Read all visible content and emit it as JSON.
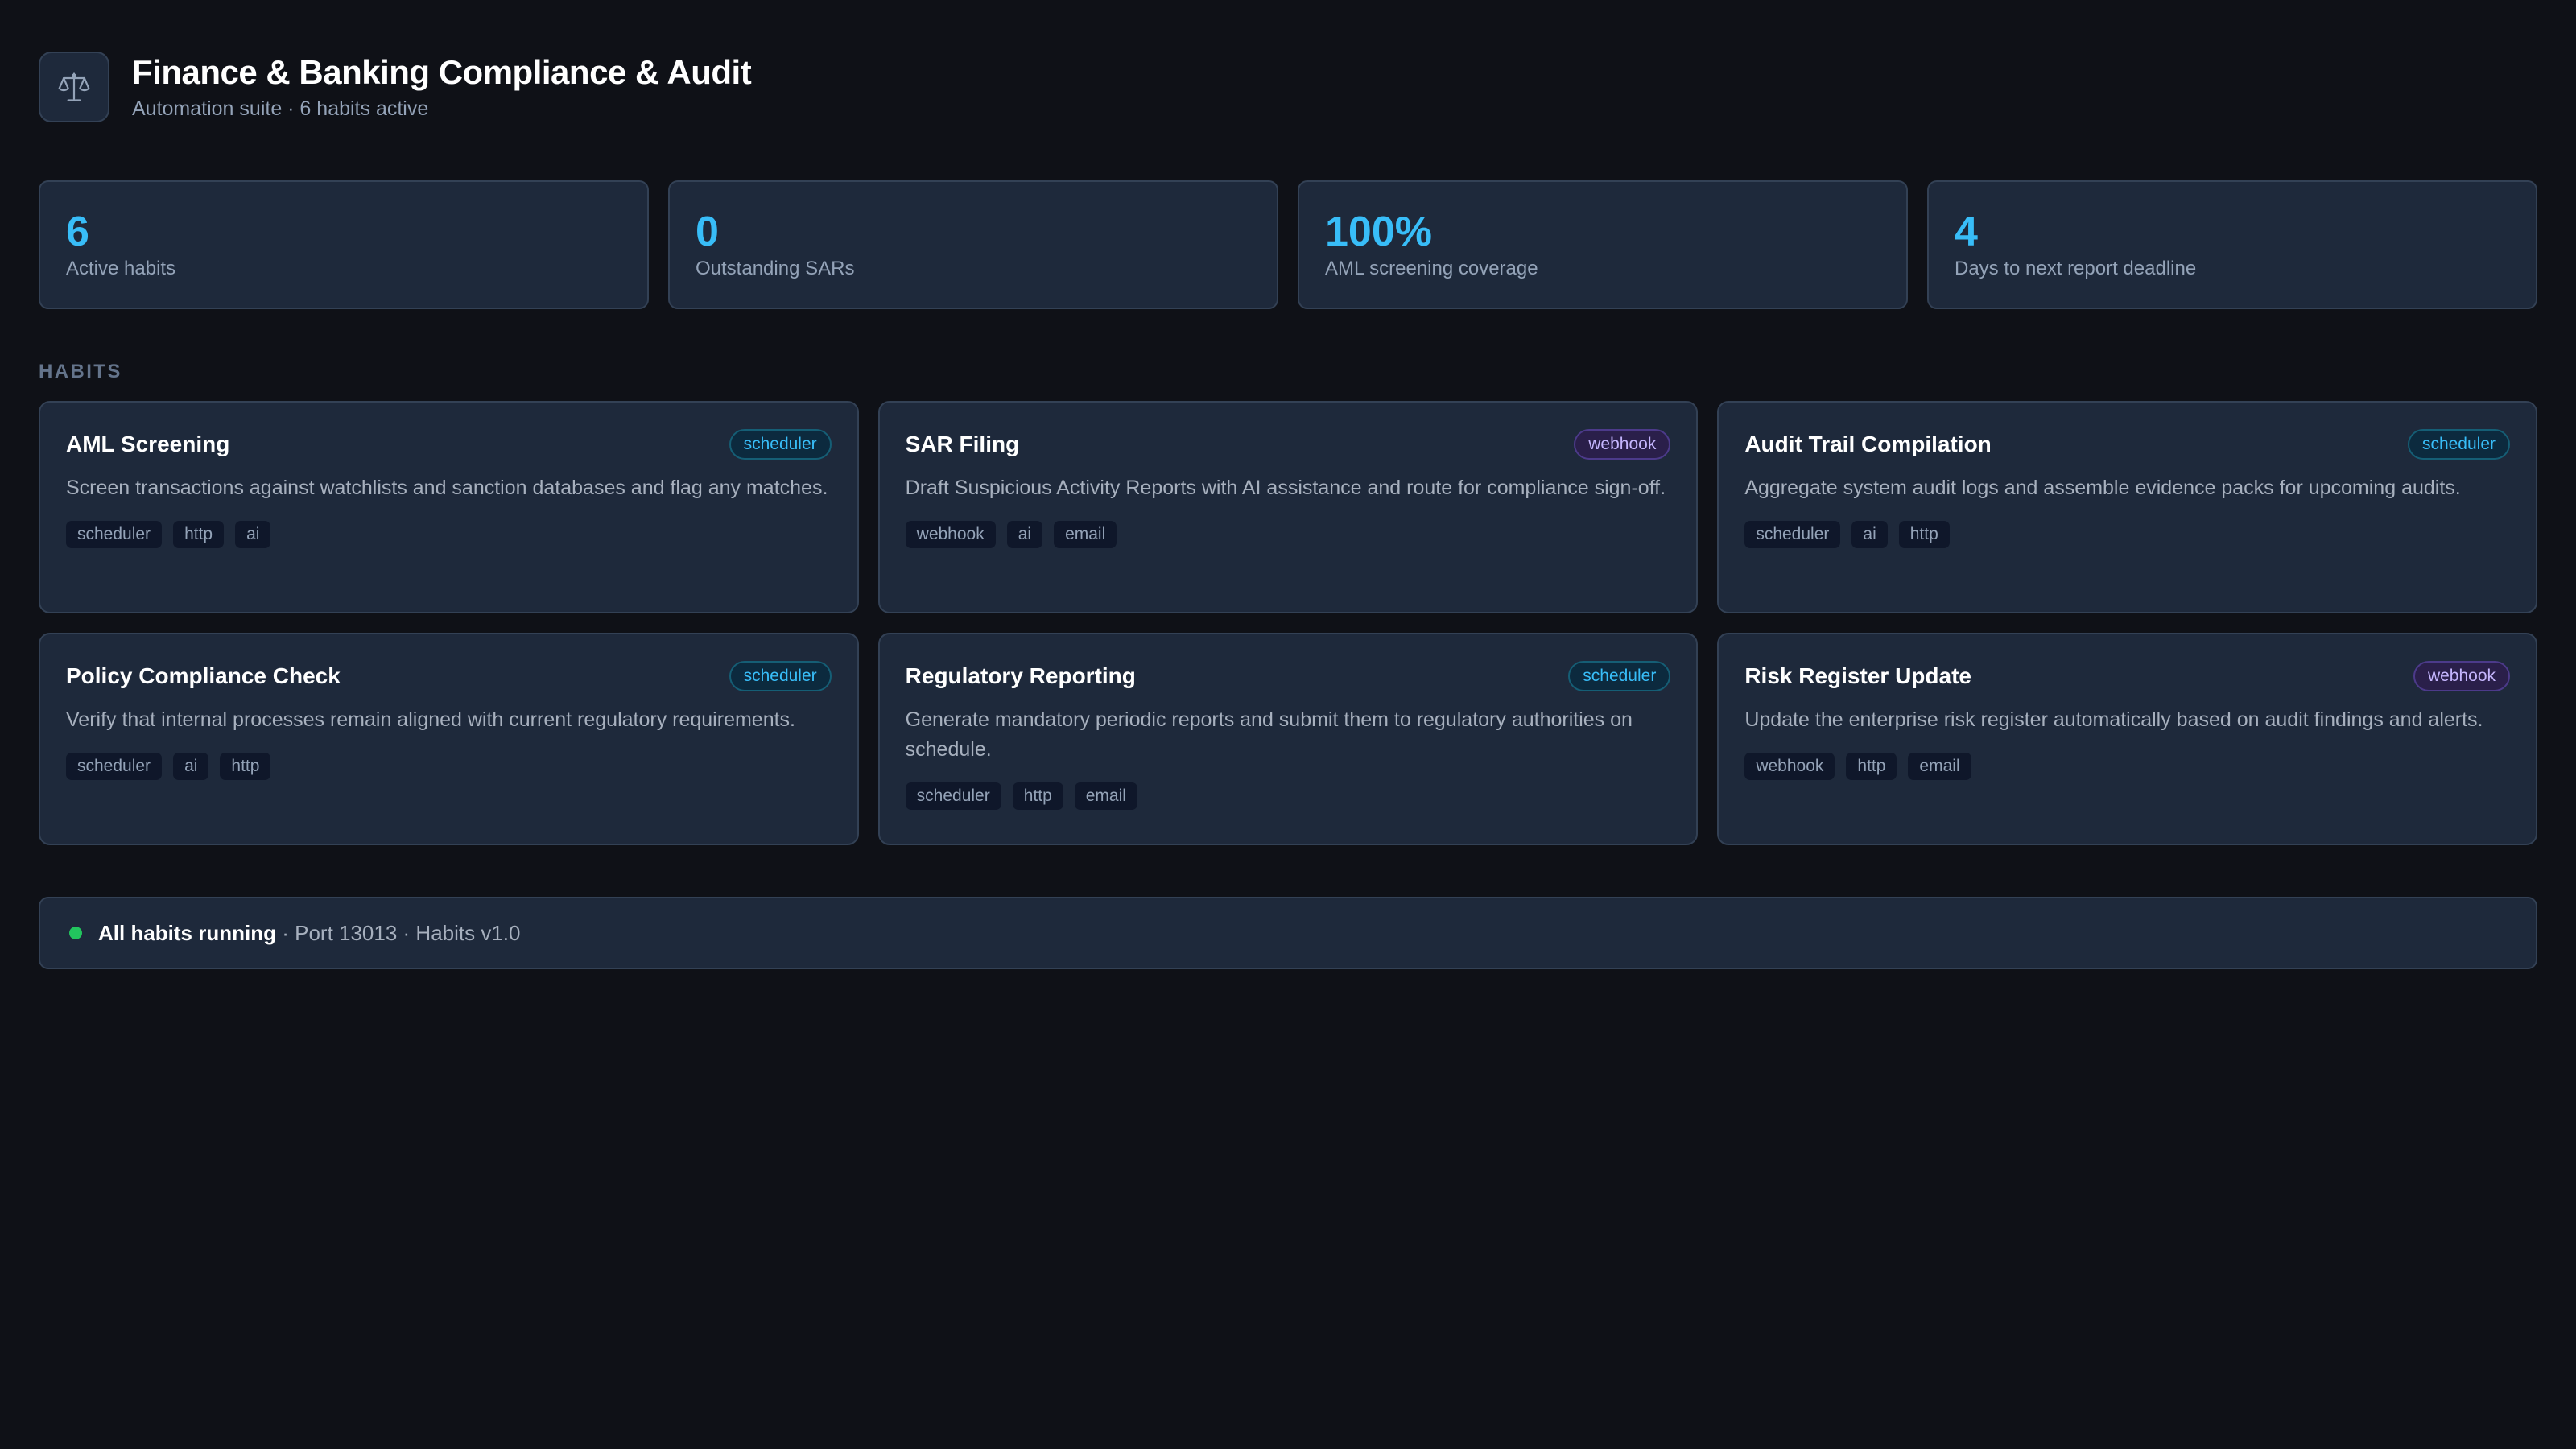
{
  "header": {
    "title": "Finance & Banking Compliance & Audit",
    "subtitle": "Automation suite · 6 habits active",
    "logo_icon": "scales-icon"
  },
  "stats": [
    {
      "value": "6",
      "label": "Active habits"
    },
    {
      "value": "0",
      "label": "Outstanding SARs"
    },
    {
      "value": "100%",
      "label": "AML screening coverage"
    },
    {
      "value": "4",
      "label": "Days to next report deadline"
    }
  ],
  "section_label": "HABITS",
  "habits": [
    {
      "title": "AML Screening",
      "badge": "scheduler",
      "description": "Screen transactions against watchlists and sanction databases and flag any matches.",
      "tags": [
        "scheduler",
        "http",
        "ai"
      ]
    },
    {
      "title": "SAR Filing",
      "badge": "webhook",
      "description": "Draft Suspicious Activity Reports with AI assistance and route for compliance sign-off.",
      "tags": [
        "webhook",
        "ai",
        "email"
      ]
    },
    {
      "title": "Audit Trail Compilation",
      "badge": "scheduler",
      "description": "Aggregate system audit logs and assemble evidence packs for upcoming audits.",
      "tags": [
        "scheduler",
        "ai",
        "http"
      ]
    },
    {
      "title": "Policy Compliance Check",
      "badge": "scheduler",
      "description": "Verify that internal processes remain aligned with current regulatory requirements.",
      "tags": [
        "scheduler",
        "ai",
        "http"
      ]
    },
    {
      "title": "Regulatory Reporting",
      "badge": "scheduler",
      "description": "Generate mandatory periodic reports and submit them to regulatory authorities on schedule.",
      "tags": [
        "scheduler",
        "http",
        "email"
      ]
    },
    {
      "title": "Risk Register Update",
      "badge": "webhook",
      "description": "Update the enterprise risk register automatically based on audit findings and alerts.",
      "tags": [
        "webhook",
        "http",
        "email"
      ]
    }
  ],
  "status": {
    "strong": "All habits running",
    "rest": " · Port 13013 · Habits v1.0"
  },
  "colors": {
    "background": "#0f1117",
    "card": "#1e293b",
    "accent": "#38bdf8",
    "status_ok": "#22c55e",
    "webhook": "#c4b5fd"
  }
}
